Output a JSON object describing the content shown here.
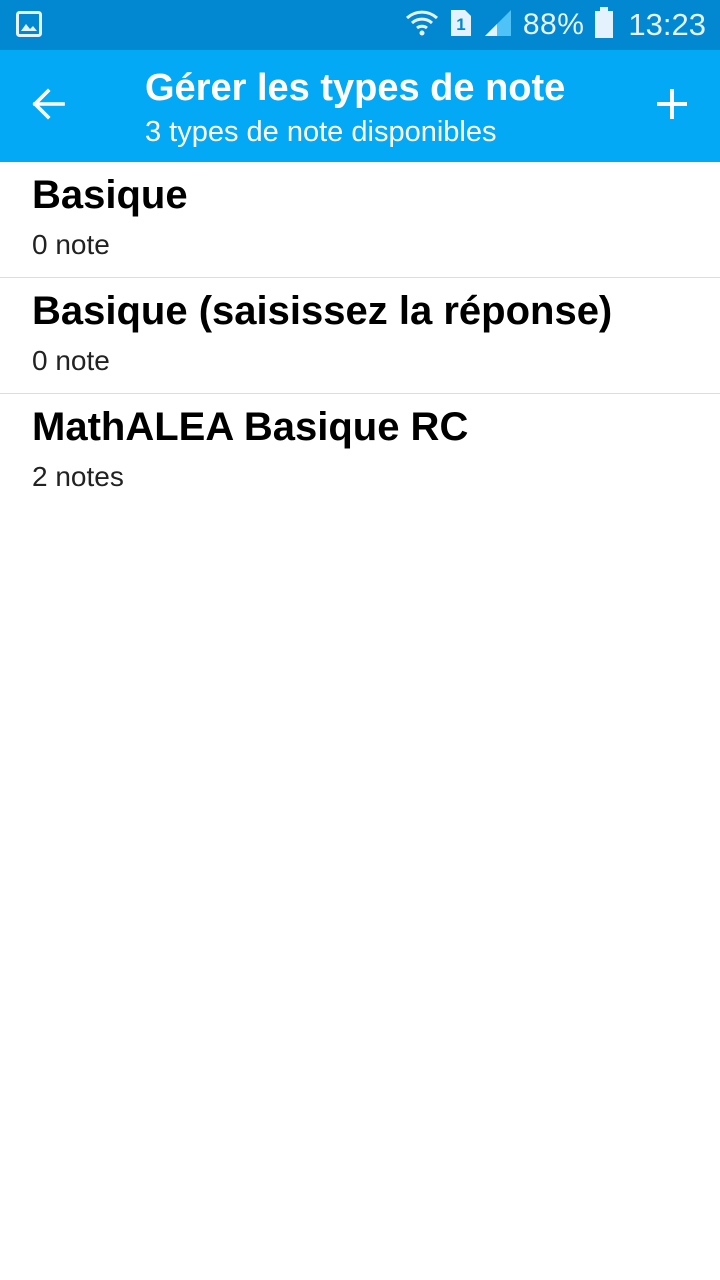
{
  "status_bar": {
    "battery_percent": "88%",
    "time": "13:23",
    "sim_label": "1",
    "icons": [
      "image-icon",
      "wifi-icon",
      "sim-icon",
      "signal-icon",
      "battery-icon"
    ]
  },
  "app_bar": {
    "title": "Gérer les types de note",
    "subtitle": "3 types de note disponibles",
    "back_icon": "arrow-back-icon",
    "add_icon": "plus-icon",
    "color": "#03a9f4"
  },
  "note_types": [
    {
      "name": "Basique",
      "count": "0 note"
    },
    {
      "name": "Basique (saisissez la réponse)",
      "count": "0 note"
    },
    {
      "name": "MathALEA Basique RC",
      "count": "2 notes"
    }
  ]
}
